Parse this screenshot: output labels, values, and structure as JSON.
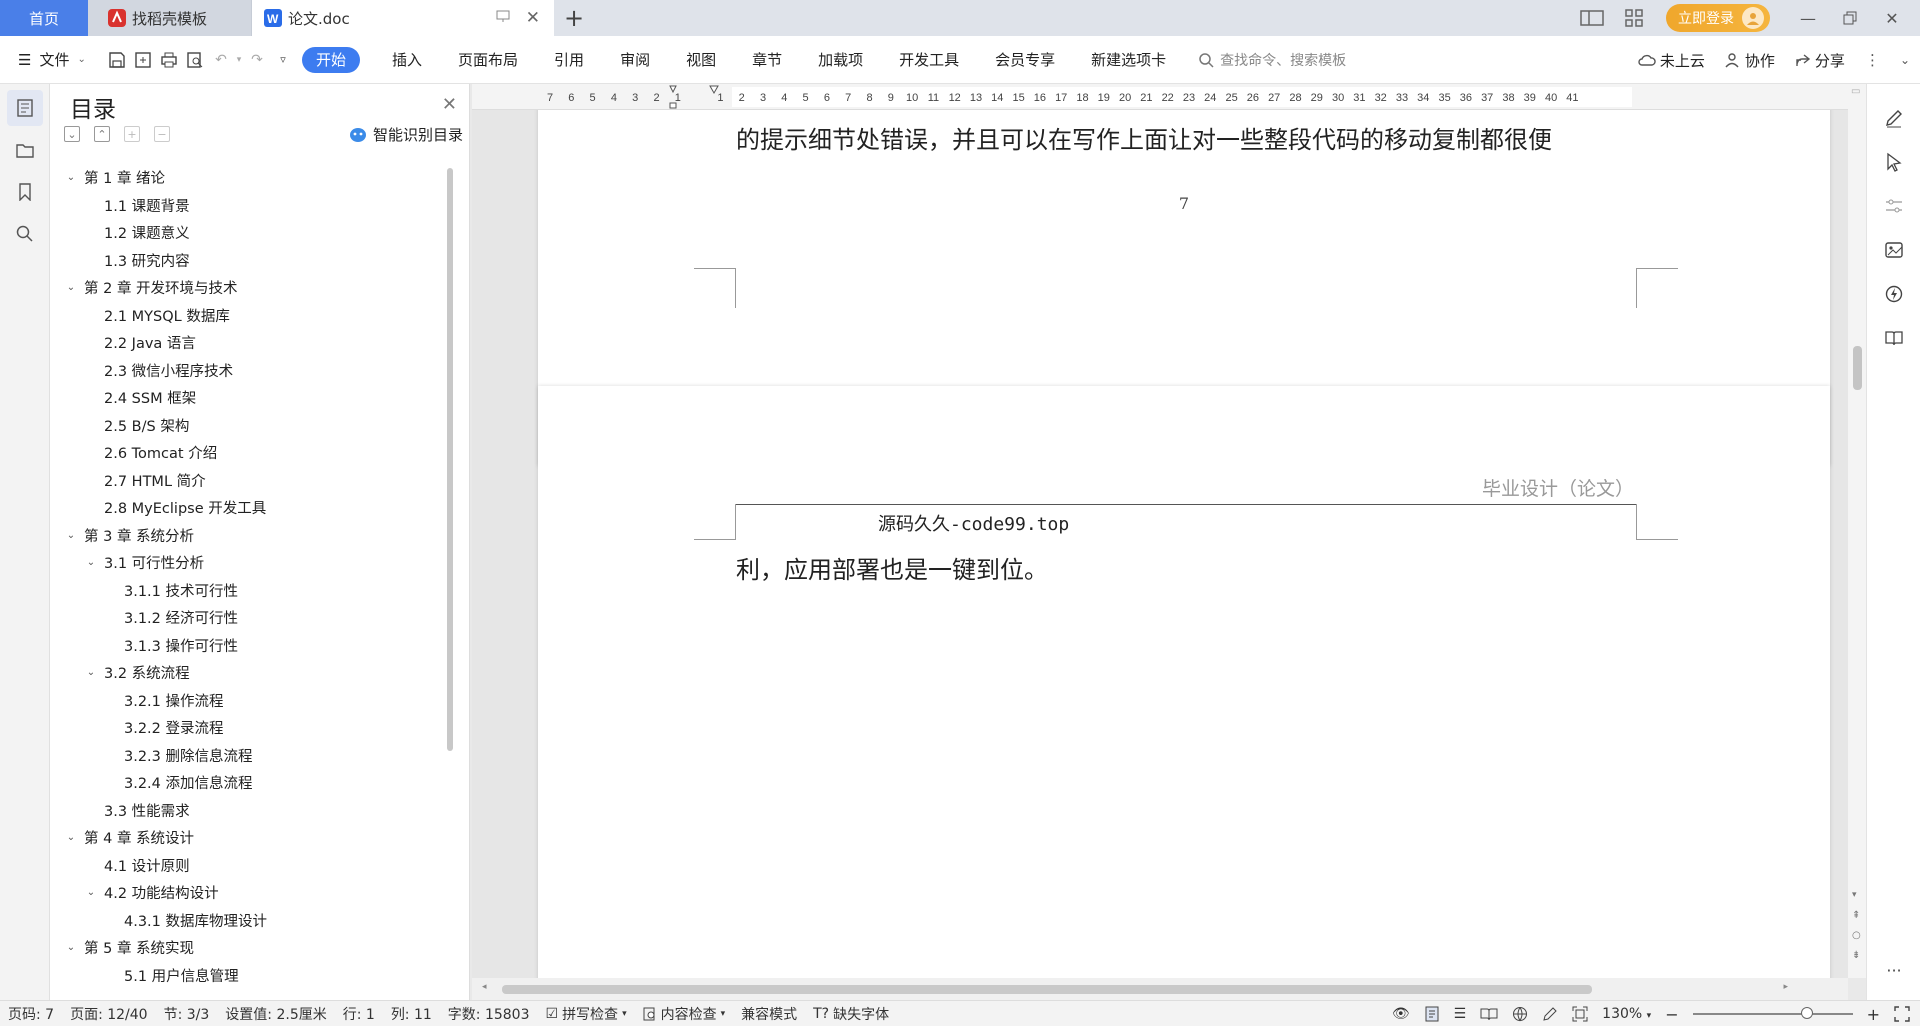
{
  "tabs": {
    "home": "首页",
    "template": "找稻壳模板",
    "doc": "论文.doc"
  },
  "window": {
    "login": "立即登录"
  },
  "toolbar": {
    "file": "文件",
    "menu_tabs": [
      "开始",
      "插入",
      "页面布局",
      "引用",
      "审阅",
      "视图",
      "章节",
      "加载项",
      "开发工具",
      "会员专享",
      "新建选项卡"
    ],
    "search_placeholder": "查找命令、搜索模板",
    "cloud": "未上云",
    "collab": "协作",
    "share": "分享"
  },
  "toc": {
    "title": "目录",
    "smart": "智能识别目录",
    "items": [
      {
        "level": 1,
        "expanded": true,
        "text": "第 1 章  绪论"
      },
      {
        "level": 2,
        "text": "1.1  课题背景"
      },
      {
        "level": 2,
        "text": "1.2  课题意义"
      },
      {
        "level": 2,
        "text": "1.3  研究内容"
      },
      {
        "level": 1,
        "expanded": true,
        "text": "第 2 章  开发环境与技术"
      },
      {
        "level": 2,
        "text": "2.1 MYSQL 数据库"
      },
      {
        "level": 2,
        "text": "2.2 Java 语言"
      },
      {
        "level": 2,
        "text": "2.3  微信小程序技术"
      },
      {
        "level": 2,
        "text": "2.4 SSM 框架"
      },
      {
        "level": 2,
        "text": "2.5 B/S 架构"
      },
      {
        "level": 2,
        "text": "2.6 Tomcat  介绍"
      },
      {
        "level": 2,
        "text": "2.7 HTML 简介"
      },
      {
        "level": 2,
        "text": "2.8 MyEclipse 开发工具"
      },
      {
        "level": 1,
        "expanded": true,
        "text": "第 3 章  系统分析"
      },
      {
        "level": 2,
        "expanded": true,
        "text": "3.1  可行性分析"
      },
      {
        "level": 3,
        "text": "3.1.1  技术可行性"
      },
      {
        "level": 3,
        "text": "3.1.2  经济可行性"
      },
      {
        "level": 3,
        "text": "3.1.3  操作可行性"
      },
      {
        "level": 2,
        "expanded": true,
        "text": "3.2  系统流程"
      },
      {
        "level": 3,
        "text": "3.2.1  操作流程"
      },
      {
        "level": 3,
        "text": "3.2.2  登录流程"
      },
      {
        "level": 3,
        "text": "3.2.3  删除信息流程"
      },
      {
        "level": 3,
        "text": "3.2.4  添加信息流程"
      },
      {
        "level": 2,
        "text": "3.3  性能需求"
      },
      {
        "level": 1,
        "expanded": true,
        "text": "第 4 章  系统设计"
      },
      {
        "level": 2,
        "text": "4.1  设计原则"
      },
      {
        "level": 2,
        "expanded": true,
        "text": "4.2  功能结构设计"
      },
      {
        "level": 3,
        "text": "4.3.1  数据库物理设计"
      },
      {
        "level": 1,
        "expanded": true,
        "text": "第 5 章  系统实现"
      },
      {
        "level": 3,
        "text": "5.1 用户信息管理"
      }
    ]
  },
  "ruler": {
    "numbers": [
      "7",
      "6",
      "5",
      "4",
      "3",
      "2",
      "1",
      "",
      "1",
      "2",
      "3",
      "4",
      "5",
      "6",
      "7",
      "8",
      "9",
      "10",
      "11",
      "12",
      "13",
      "14",
      "15",
      "16",
      "17",
      "18",
      "19",
      "20",
      "21",
      "22",
      "23",
      "24",
      "25",
      "26",
      "27",
      "28",
      "29",
      "30",
      "31",
      "32",
      "33",
      "34",
      "35",
      "36",
      "37",
      "38",
      "39",
      "40",
      "41"
    ]
  },
  "document": {
    "page1_text": "的提示细节处错误，并且可以在写作上面让对一些整段代码的移动复制都很便",
    "page1_number": "7",
    "page2_header": "毕业设计（论文）",
    "page2_watermark": "源码久久-code99.top",
    "page2_text": "利，应用部署也是一键到位。"
  },
  "status": {
    "page_code": "页码: 7",
    "page": "页面: 12/40",
    "section": "节: 3/3",
    "setting": "设置值: 2.5厘米",
    "row": "行: 1",
    "col": "列: 11",
    "words": "字数: 15803",
    "spell": "拼写检查",
    "content_check": "内容检查",
    "compat": "兼容模式",
    "missing_font": "缺失字体",
    "zoom": "130%"
  },
  "colors": {
    "accent": "#3d7cf0",
    "login": "#f0a72c"
  }
}
